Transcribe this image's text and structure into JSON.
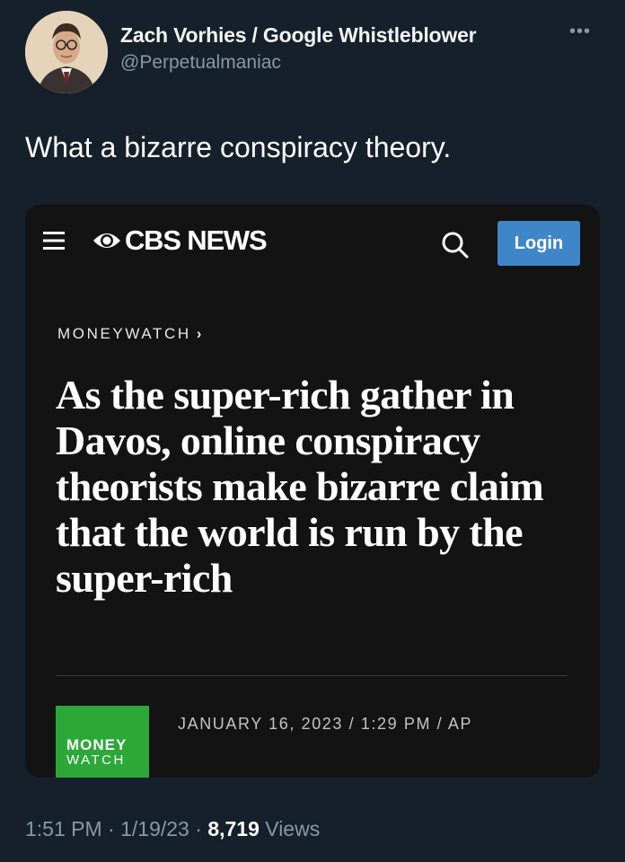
{
  "author": {
    "name": "Zach Vorhies / Google Whistleblower",
    "handle": "@Perpetualmaniac"
  },
  "tweet": {
    "text": "What a bizarre conspiracy theory."
  },
  "card": {
    "brand": "CBS NEWS",
    "login_label": "Login",
    "section_label": "MONEYWATCH",
    "section_chevron": "›",
    "headline": "As the super-rich gather in Davos, online conspiracy theorists make bizarre claim that the world is run by the super-rich",
    "logo": {
      "line1": "MONEY",
      "line2": "WATCH",
      "color": "#2ca838"
    },
    "dateline": "JANUARY 16, 2023 / 1:29 PM / AP",
    "accent_color": "#3f86c9"
  },
  "meta": {
    "time": "1:51 PM",
    "separator": "·",
    "date": "1/19/23",
    "views_count": "8,719",
    "views_label": "Views"
  },
  "icons": {
    "more": "more-dots-icon",
    "menu": "hamburger-menu-icon",
    "search": "search-icon",
    "brand": "cbs-eye-icon"
  },
  "colors": {
    "background": "#15202b",
    "card_background": "#131313",
    "secondary_text": "#8899a6"
  }
}
